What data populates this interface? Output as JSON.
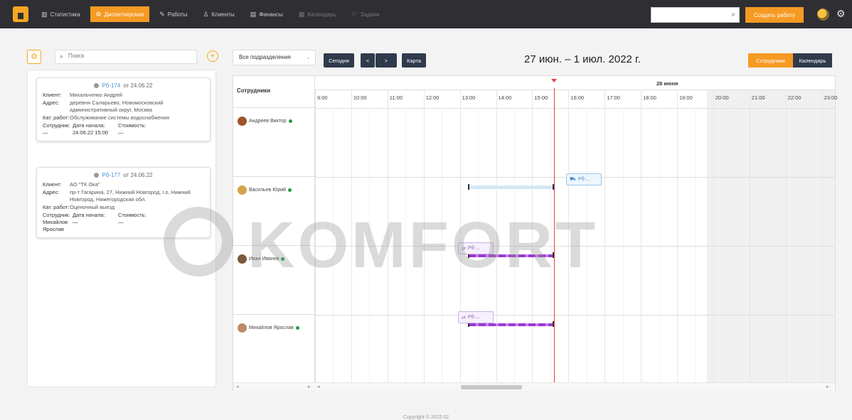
{
  "nav": {
    "items": [
      {
        "icon": "chart-icon",
        "glyph": "▥",
        "label": "Статистика",
        "active": false,
        "dim": false
      },
      {
        "icon": "dispatcher-icon",
        "glyph": "⚙",
        "label": "Диспетчерская",
        "active": true,
        "dim": false
      },
      {
        "icon": "wrench-icon",
        "glyph": "✎",
        "label": "Работы",
        "active": false,
        "dim": false
      },
      {
        "icon": "user-icon",
        "glyph": "♙",
        "label": "Клиенты",
        "active": false,
        "dim": false
      },
      {
        "icon": "finance-icon",
        "glyph": "▤",
        "label": "Финансы",
        "active": false,
        "dim": false
      },
      {
        "icon": "calendar-icon",
        "glyph": "▦",
        "label": "Календарь",
        "active": false,
        "dim": true
      },
      {
        "icon": "tasks-icon",
        "glyph": "⚐",
        "label": "Задачи",
        "active": false,
        "dim": true
      }
    ],
    "search_placeholder": "",
    "create_label": "Создать работу"
  },
  "left": {
    "search_placeholder": "Поиск",
    "orders": [
      {
        "number": "Рб-174",
        "date": "от 24.06.22",
        "client_key": "Клиент:",
        "client": "Михальченко Андрей",
        "address_key": "Адрес:",
        "address": "деревня Саларьево, Новомосковский административный округ, Москва",
        "work_key": "Кат. работ:",
        "work": "Обслуживание системы водоснабжения",
        "col1": "Сотрудник:",
        "col2": "Дата начала:",
        "col3": "Стоимость:",
        "val1": "—",
        "val2": "24.06.22 15:00",
        "val3": "—"
      },
      {
        "number": "Рб-177",
        "date": "от 24.06.22",
        "client_key": "Клиент:",
        "client": "АО \"ТК Ока\"",
        "address_key": "Адрес:",
        "address": "пр-т Гагарина, 27, Нижний Новгород, г.о. Нижний Новгород, Нижегородская обл.",
        "work_key": "Кат. работ:",
        "work": "Оценочный выезд",
        "col1": "Сотрудник:",
        "col2": "Дата начала:",
        "col3": "Стоимость:",
        "val1": "Михайлов Ярослав",
        "val2": "—",
        "val3": "—"
      }
    ]
  },
  "toolbar": {
    "division_select": "Все подразделения",
    "today": "Сегодня",
    "prev": "<",
    "next": ">",
    "map": "Карта",
    "range": "27 июн. – 1 июл. 2022 г.",
    "view_employees": "Сотрудники",
    "view_calendar": "Календарь"
  },
  "grid": {
    "employees_header": "Сотрудники",
    "day_label": "28 июня",
    "hours": [
      "9:00",
      "10:00",
      "11:00",
      "12:00",
      "13:00",
      "14:00",
      "15:00",
      "16:00",
      "17:00",
      "18:00",
      "19:00",
      "20:00",
      "21:00",
      "22:00",
      "23:00"
    ],
    "employees": [
      {
        "name": "Андреев Виктор",
        "avatar_color": "#a0522d"
      },
      {
        "name": "Васильев Юрий",
        "avatar_color": "#d4a24a"
      },
      {
        "name": "Иван Иванов",
        "avatar_color": "#7a5a3a"
      },
      {
        "name": "Михайлов Ярослав",
        "avatar_color": "#c08a6a"
      }
    ],
    "chips": [
      "Рб-...",
      "Рб-...",
      "Рб-..."
    ]
  },
  "watermark": "KOMFORT",
  "footer": "Copyright © 2022 02"
}
